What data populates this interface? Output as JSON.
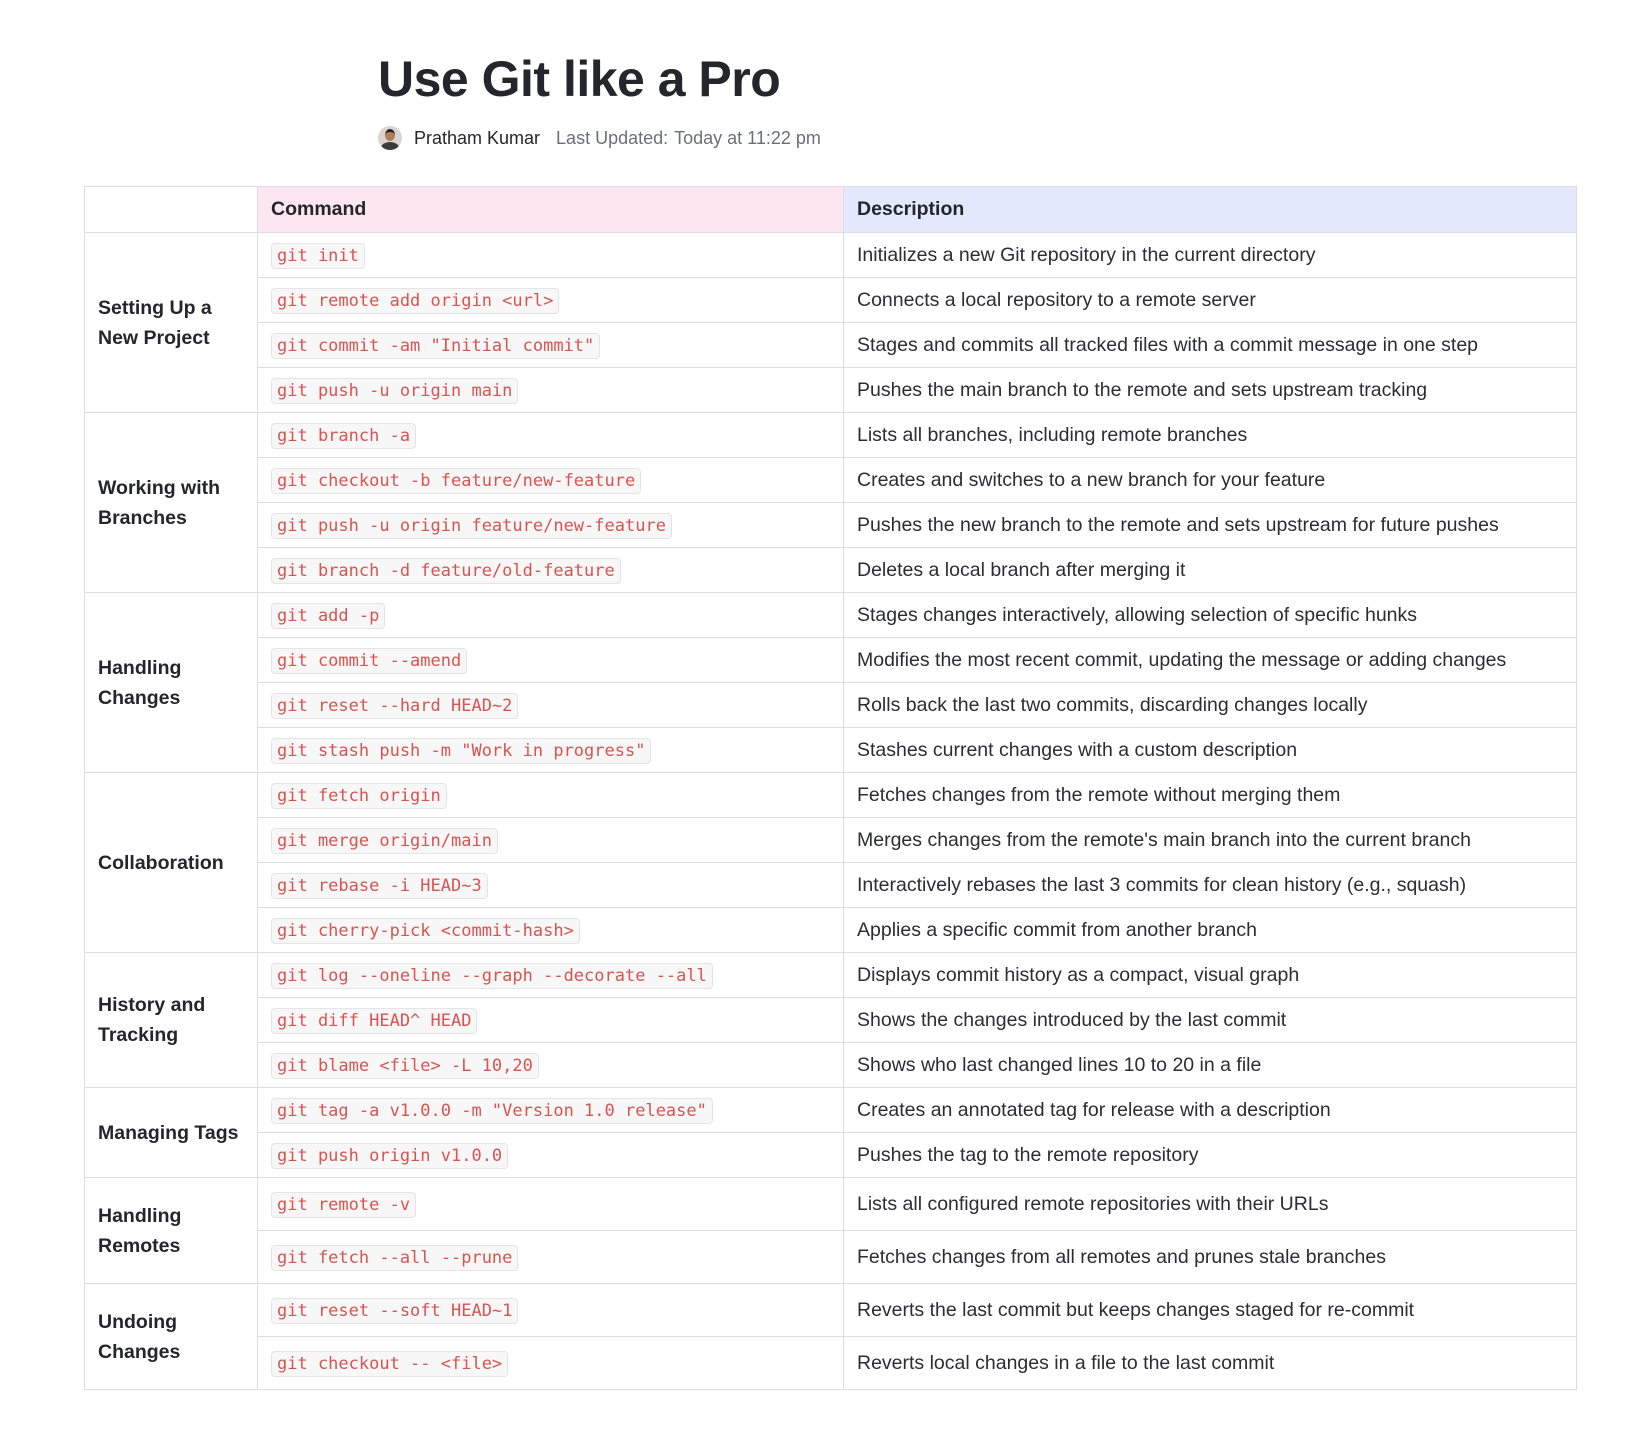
{
  "title": "Use Git like a Pro",
  "meta": {
    "author": "Pratham Kumar",
    "updated_label": "Last Updated:",
    "updated_value": "Today at 11:22 pm"
  },
  "table": {
    "headers": {
      "command": "Command",
      "description": "Description"
    },
    "groups": [
      {
        "name": "Setting Up a New Project",
        "rows": [
          {
            "cmd": "git init",
            "desc": "Initializes a new Git repository in the current directory"
          },
          {
            "cmd": "git remote add origin <url>",
            "desc": "Connects a local repository to a remote server"
          },
          {
            "cmd": "git commit -am \"Initial commit\"",
            "desc": "Stages and commits all tracked files with a commit message in one step"
          },
          {
            "cmd": "git push -u origin main",
            "desc": "Pushes the main branch to the remote and sets upstream tracking"
          }
        ]
      },
      {
        "name": "Working with Branches",
        "rows": [
          {
            "cmd": "git branch -a",
            "desc": "Lists all branches, including remote branches"
          },
          {
            "cmd": "git checkout -b feature/new-feature",
            "desc": "Creates and switches to a new branch for your feature"
          },
          {
            "cmd": "git push -u origin feature/new-feature",
            "desc": "Pushes the new branch to the remote and sets upstream for future pushes"
          },
          {
            "cmd": "git branch -d feature/old-feature",
            "desc": "Deletes a local branch after merging it"
          }
        ]
      },
      {
        "name": "Handling Changes",
        "rows": [
          {
            "cmd": "git add -p",
            "desc": "Stages changes interactively, allowing selection of specific hunks"
          },
          {
            "cmd": "git commit --amend",
            "desc": "Modifies the most recent commit, updating the message or adding changes"
          },
          {
            "cmd": "git reset --hard HEAD~2",
            "desc": "Rolls back the last two commits, discarding changes locally"
          },
          {
            "cmd": "git stash push -m \"Work in progress\"",
            "desc": "Stashes current changes with a custom description"
          }
        ]
      },
      {
        "name": "Collaboration",
        "rows": [
          {
            "cmd": "git fetch origin",
            "desc": "Fetches changes from the remote without merging them"
          },
          {
            "cmd": "git merge origin/main",
            "desc": "Merges changes from the remote's main branch into the current branch"
          },
          {
            "cmd": "git rebase -i HEAD~3",
            "desc": "Interactively rebases the last 3 commits for clean history (e.g., squash)"
          },
          {
            "cmd": "git cherry-pick <commit-hash>",
            "desc": "Applies a specific commit from another branch"
          }
        ]
      },
      {
        "name": "History and Tracking",
        "rows": [
          {
            "cmd": "git log --oneline --graph --decorate --all",
            "desc": "Displays commit history as a compact, visual graph"
          },
          {
            "cmd": "git diff HEAD^ HEAD",
            "desc": "Shows the changes introduced by the last commit"
          },
          {
            "cmd": "git blame <file> -L 10,20",
            "desc": "Shows who last changed lines 10 to 20 in a file"
          }
        ]
      },
      {
        "name": "Managing Tags",
        "rows": [
          {
            "cmd": "git tag -a v1.0.0 -m \"Version 1.0 release\"",
            "desc": "Creates an annotated tag for release with a description"
          },
          {
            "cmd": "git push origin v1.0.0",
            "desc": "Pushes the tag to the remote repository"
          }
        ]
      },
      {
        "name": "Handling Remotes",
        "rows": [
          {
            "cmd": "git remote -v",
            "desc": "Lists all configured remote repositories with their URLs"
          },
          {
            "cmd": "git fetch --all --prune",
            "desc": "Fetches changes from all remotes and prunes stale branches"
          }
        ]
      },
      {
        "name": "Undoing Changes",
        "rows": [
          {
            "cmd": "git reset --soft HEAD~1",
            "desc": "Reverts the last commit but keeps changes staged for re-commit"
          },
          {
            "cmd": "git checkout -- <file>",
            "desc": "Reverts local changes in a file to the last commit"
          }
        ]
      }
    ]
  }
}
